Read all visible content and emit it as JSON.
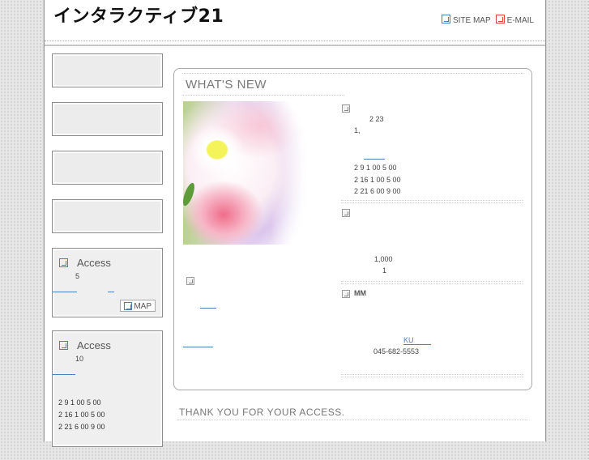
{
  "header": {
    "title": "インタラクティブ21",
    "nav": [
      {
        "label": "SITE MAP",
        "color": "#4a7fc1"
      },
      {
        "label": "E-MAIL",
        "color": "#d84a4a"
      }
    ]
  },
  "sidebar": {
    "buttons": [
      "",
      "",
      "",
      ""
    ],
    "access1": {
      "title": "Access",
      "line": "5",
      "map_label": "MAP"
    },
    "access2": {
      "title": "Access",
      "line": "10",
      "hours": [
        "2 9 1 00 5 00",
        "2 16 1 00 5 00",
        "2 21 6 00 9 00"
      ]
    }
  },
  "whats_new": {
    "title": "WHAT'S NEW",
    "item1": {
      "l1": "2 23",
      "l2": "1,"
    },
    "hours": [
      "2 9 1 00 5 00",
      "2 16 1 00 5 00",
      "2 21 6 00 9 00"
    ],
    "item2": {
      "l1": "1,000",
      "l2": "1"
    },
    "item3": {
      "label": "MM",
      "link": "KU",
      "tel": "045-682-5553"
    }
  },
  "footer": {
    "thanks": "THANK YOU FOR YOUR ACCESS."
  }
}
